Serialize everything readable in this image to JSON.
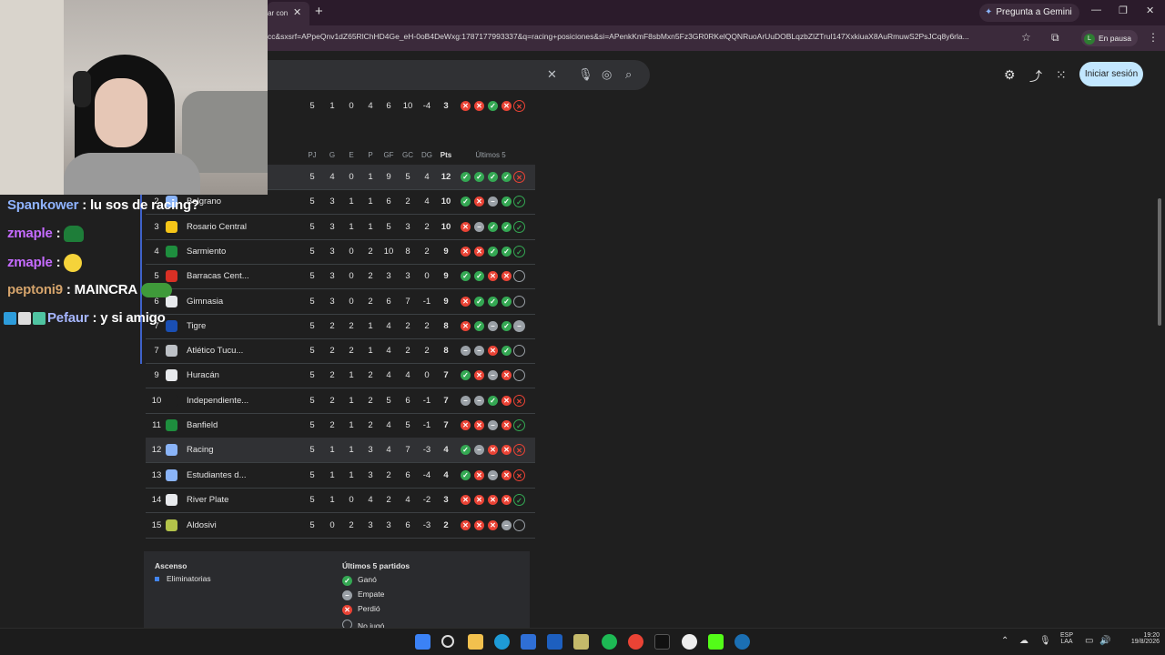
{
  "browser": {
    "tab_title": "ar con",
    "url": "cc&sxsrf=APpeQnv1dZ65RlChHD4Ge_eH-0oB4DeWxg:1787177993337&q=racing+posiciones&si=APenkKmF8sbMxn5Fz3GR0RKelQQNRuoArUuDOBLqzbZlZTrul147XxkiuaX8AuRmuwS2PsJCq8y6rla...",
    "gemini_label": "Pregunta a Gemini",
    "profile_initial": "L",
    "profile_status": "En pausa"
  },
  "google": {
    "signin_label": "Iniciar sesión"
  },
  "prev_row": [
    "5",
    "1",
    "0",
    "4",
    "6",
    "10",
    "-4",
    "3"
  ],
  "prev_form": [
    "L",
    "L",
    "W",
    "L",
    "L"
  ],
  "table": {
    "headers": [
      "PJ",
      "G",
      "E",
      "P",
      "GF",
      "GC",
      "DG",
      "Pts"
    ],
    "last5_header": "Últimos 5",
    "rows": [
      {
        "pos": "",
        "team": "",
        "stats": [
          "5",
          "4",
          "0",
          "1",
          "9",
          "5",
          "4",
          "12"
        ],
        "form": [
          "W",
          "W",
          "W",
          "W",
          "L"
        ],
        "logo": "#5b5f66"
      },
      {
        "pos": "2",
        "team": "Belgrano",
        "stats": [
          "5",
          "3",
          "1",
          "1",
          "6",
          "2",
          "4",
          "10"
        ],
        "form": [
          "W",
          "L",
          "D",
          "W",
          "W"
        ],
        "logo": "#8ab4f8"
      },
      {
        "pos": "3",
        "team": "Rosario Central",
        "stats": [
          "5",
          "3",
          "1",
          "1",
          "5",
          "3",
          "2",
          "10"
        ],
        "form": [
          "L",
          "D",
          "W",
          "W",
          "W"
        ],
        "logo": "#f5c518"
      },
      {
        "pos": "4",
        "team": "Sarmiento",
        "stats": [
          "5",
          "3",
          "0",
          "2",
          "10",
          "8",
          "2",
          "9"
        ],
        "form": [
          "L",
          "L",
          "W",
          "W",
          "W"
        ],
        "logo": "#1e8e3e"
      },
      {
        "pos": "5",
        "team": "Barracas Cent...",
        "stats": [
          "5",
          "3",
          "0",
          "2",
          "3",
          "3",
          "0",
          "9"
        ],
        "form": [
          "W",
          "W",
          "L",
          "L",
          "N"
        ],
        "logo": "#d93025"
      },
      {
        "pos": "6",
        "team": "Gimnasia",
        "stats": [
          "5",
          "3",
          "0",
          "2",
          "6",
          "7",
          "-1",
          "9"
        ],
        "form": [
          "L",
          "W",
          "W",
          "W",
          "N"
        ],
        "logo": "#e8eaed"
      },
      {
        "pos": "7",
        "team": "Tigre",
        "stats": [
          "5",
          "2",
          "2",
          "1",
          "4",
          "2",
          "2",
          "8"
        ],
        "form": [
          "L",
          "W",
          "D",
          "W",
          "D"
        ],
        "logo": "#1a4fb3"
      },
      {
        "pos": "7",
        "team": "Atlético Tucu...",
        "stats": [
          "5",
          "2",
          "2",
          "1",
          "4",
          "2",
          "2",
          "8"
        ],
        "form": [
          "D",
          "D",
          "L",
          "W",
          "N"
        ],
        "logo": "#bdc1c6"
      },
      {
        "pos": "9",
        "team": "Huracán",
        "stats": [
          "5",
          "2",
          "1",
          "2",
          "4",
          "4",
          "0",
          "7"
        ],
        "form": [
          "W",
          "L",
          "D",
          "L",
          "N"
        ],
        "logo": "#e8eaed"
      },
      {
        "pos": "10",
        "team": "Independiente...",
        "stats": [
          "5",
          "2",
          "1",
          "2",
          "5",
          "6",
          "-1",
          "7"
        ],
        "form": [
          "D",
          "D",
          "W",
          "L",
          "L"
        ],
        "logo": "#1f1f1f"
      },
      {
        "pos": "11",
        "team": "Banfield",
        "stats": [
          "5",
          "2",
          "1",
          "2",
          "4",
          "5",
          "-1",
          "7"
        ],
        "form": [
          "L",
          "L",
          "D",
          "L",
          "W"
        ],
        "logo": "#1e8e3e"
      },
      {
        "pos": "12",
        "team": "Racing",
        "stats": [
          "5",
          "1",
          "1",
          "3",
          "4",
          "7",
          "-3",
          "4"
        ],
        "form": [
          "W",
          "D",
          "L",
          "L",
          "L"
        ],
        "logo": "#8ab4f8"
      },
      {
        "pos": "13",
        "team": "Estudiantes d...",
        "stats": [
          "5",
          "1",
          "1",
          "3",
          "2",
          "6",
          "-4",
          "4"
        ],
        "form": [
          "W",
          "L",
          "D",
          "L",
          "L"
        ],
        "logo": "#8ab4f8"
      },
      {
        "pos": "14",
        "team": "River Plate",
        "stats": [
          "5",
          "1",
          "0",
          "4",
          "2",
          "4",
          "-2",
          "3"
        ],
        "form": [
          "L",
          "L",
          "L",
          "L",
          "W"
        ],
        "logo": "#e8eaed"
      },
      {
        "pos": "15",
        "team": "Aldosivi",
        "stats": [
          "5",
          "0",
          "2",
          "3",
          "3",
          "6",
          "-3",
          "2"
        ],
        "form": [
          "L",
          "L",
          "L",
          "D",
          "N"
        ],
        "logo": "#b3c34a"
      }
    ]
  },
  "legend": {
    "ascenso_title": "Ascenso",
    "ascenso_item": "Eliminatorias",
    "last5_title": "Últimos 5 partidos",
    "won": "Ganó",
    "draw": "Empate",
    "lost": "Perdió",
    "not_played": "No jugó",
    "colors": {
      "won": "#34a853",
      "draw": "#9aa0a6",
      "lost": "#ea4335",
      "ascenso": "#4285f4"
    }
  },
  "chat": [
    {
      "user": "Spankower",
      "text": " : lu sos de racing?"
    },
    {
      "user": "zmaple",
      "text": " :"
    },
    {
      "user": "zmaple",
      "text": " :"
    },
    {
      "user": "peptoni9",
      "text": " : MAINCRA"
    },
    {
      "user": "Pefaur",
      "text": " : y si amigo"
    }
  ],
  "taskbar": {
    "lang": "ESP",
    "lang2": "LAA",
    "time": "19:20",
    "date": "19/8/2026"
  }
}
